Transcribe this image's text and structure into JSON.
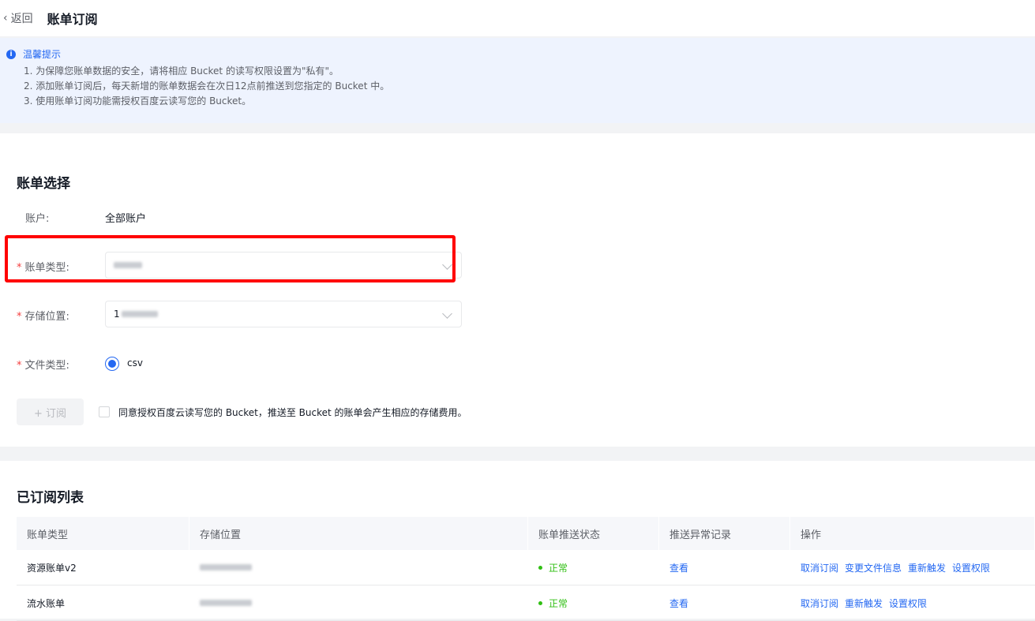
{
  "header": {
    "back_label": "返回",
    "title": "账单订阅"
  },
  "tip": {
    "title": "温馨提示",
    "items": [
      "1. 为保障您账单数据的安全，请将相应 Bucket 的读写权限设置为\"私有\"。",
      "2. 添加账单订阅后，每天新增的账单数据会在次日12点前推送到您指定的 Bucket 中。",
      "3. 使用账单订阅功能需授权百度云读写您的 Bucket。"
    ]
  },
  "bill_select": {
    "section_title": "账单选择",
    "account_label": "账户:",
    "account_value": "全部账户",
    "bill_type_label": "账单类型:",
    "storage_label": "存储位置:",
    "storage_value_prefix": "1",
    "file_type_label": "文件类型:",
    "file_type_option": "csv",
    "subscribe_button": "+ 订阅",
    "agree_text": "同意授权百度云读写您的 Bucket，推送至 Bucket 的账单会产生相应的存储费用。"
  },
  "subscribed": {
    "section_title": "已订阅列表",
    "columns": [
      "账单类型",
      "存储位置",
      "账单推送状态",
      "推送异常记录",
      "操作"
    ],
    "rows": [
      {
        "bill_type": "资源账单v2",
        "status": "正常",
        "record": "查看",
        "actions": [
          "取消订阅",
          "变更文件信息",
          "重新触发",
          "设置权限"
        ]
      },
      {
        "bill_type": "流水账单",
        "status": "正常",
        "record": "查看",
        "actions": [
          "取消订阅",
          "重新触发",
          "设置权限"
        ]
      }
    ]
  },
  "colors": {
    "accent": "#2468f2",
    "success": "#30bf13",
    "required": "#f33e3e",
    "highlight": "#ff0000"
  }
}
